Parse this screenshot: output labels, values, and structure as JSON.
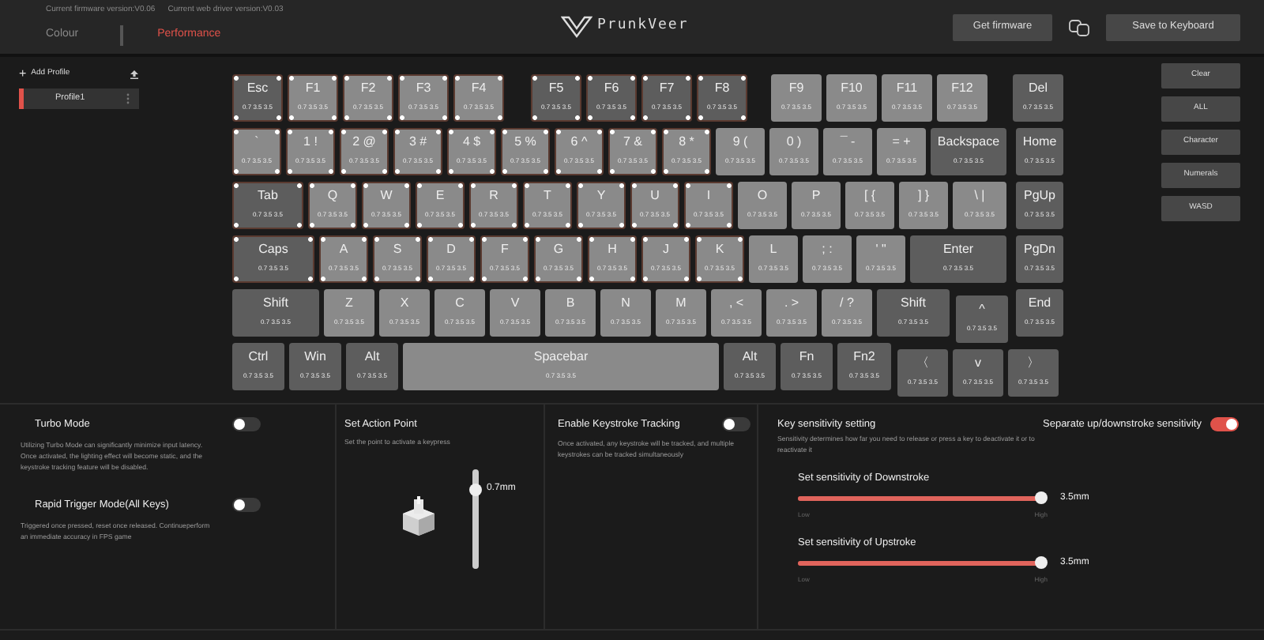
{
  "header": {
    "firmware_version": "Current firmware version:V0.06",
    "driver_version": "Current web driver version:V0.03",
    "tabs": [
      {
        "label": "Colour",
        "selected": false
      },
      {
        "label": "Performance",
        "selected": true
      }
    ],
    "logo": "PrunkVeer",
    "buttons": [
      "Get firmware",
      "Save to Keyboard"
    ]
  },
  "profiles": {
    "add_icon": "+",
    "add_label": "Add Profile",
    "items": [
      {
        "name": "Profile1",
        "selected": true
      }
    ]
  },
  "keyboard": {
    "rows": [
      {
        "keys": [
          {
            "label": "Esc",
            "values": "0.7 3.5 3.5",
            "kind": "dark",
            "selected": true
          },
          {
            "label": "F1",
            "values": "0.7 3.5 3.5",
            "kind": "light",
            "selected": true
          },
          {
            "label": "F2",
            "values": "0.7 3.5 3.5",
            "kind": "light",
            "selected": true
          },
          {
            "label": "F3",
            "values": "0.7 3.5 3.5",
            "kind": "light",
            "selected": true
          },
          {
            "label": "F4",
            "values": "0.7 3.5 3.5",
            "kind": "light",
            "selected": true
          },
          {
            "label": "F5",
            "values": "0.7 3.5 3.5",
            "kind": "dark",
            "selected": true
          },
          {
            "label": "F6",
            "values": "0.7 3.5 3.5",
            "kind": "dark",
            "selected": true
          },
          {
            "label": "F7",
            "values": "0.7 3.5 3.5",
            "kind": "dark",
            "selected": true
          },
          {
            "label": "F8",
            "values": "0.7 3.5 3.5",
            "kind": "dark",
            "selected": true
          },
          {
            "label": "F9",
            "values": "0.7 3.5 3.5",
            "kind": "light",
            "selected": false
          },
          {
            "label": "F10",
            "values": "0.7 3.5 3.5",
            "kind": "light",
            "selected": false
          },
          {
            "label": "F11",
            "values": "0.7 3.5 3.5",
            "kind": "light",
            "selected": false
          },
          {
            "label": "F12",
            "values": "0.7 3.5 3.5",
            "kind": "light",
            "selected": false
          },
          {
            "label": "Del",
            "values": "0.7 3.5 3.5",
            "kind": "dark",
            "selected": false
          }
        ]
      },
      {
        "keys": [
          {
            "label": "`",
            "values": "0.7 3.5 3.5",
            "kind": "light",
            "selected": true
          },
          {
            "label": "1 !",
            "values": "0.7 3.5 3.5",
            "kind": "light",
            "selected": true
          },
          {
            "label": "2 @",
            "values": "0.7 3.5 3.5",
            "kind": "light",
            "selected": true
          },
          {
            "label": "3 #",
            "values": "0.7 3.5 3.5",
            "kind": "light",
            "selected": true
          },
          {
            "label": "4 $",
            "values": "0.7 3.5 3.5",
            "kind": "light",
            "selected": true
          },
          {
            "label": "5 %",
            "values": "0.7 3.5 3.5",
            "kind": "light",
            "selected": true
          },
          {
            "label": "6 ^",
            "values": "0.7 3.5 3.5",
            "kind": "light",
            "selected": true
          },
          {
            "label": "7 &",
            "values": "0.7 3.5 3.5",
            "kind": "light",
            "selected": true
          },
          {
            "label": "8 *",
            "values": "0.7 3.5 3.5",
            "kind": "light",
            "selected": true
          },
          {
            "label": "9 (",
            "values": "0.7 3.5 3.5",
            "kind": "light",
            "selected": false
          },
          {
            "label": "0 )",
            "values": "0.7 3.5 3.5",
            "kind": "light",
            "selected": false
          },
          {
            "label": "¯ -",
            "values": "0.7 3.5 3.5",
            "kind": "light",
            "selected": false
          },
          {
            "label": "= +",
            "values": "0.7 3.5 3.5",
            "kind": "light",
            "selected": false
          },
          {
            "label": "Backspace",
            "values": "0.7 3.5 3.5",
            "kind": "dark",
            "selected": false
          },
          {
            "label": "Home",
            "values": "0.7 3.5 3.5",
            "kind": "dark",
            "selected": false
          }
        ]
      },
      {
        "keys": [
          {
            "label": "Tab",
            "values": "0.7 3.5 3.5",
            "kind": "dark",
            "selected": true
          },
          {
            "label": "Q",
            "values": "0.7 3.5 3.5",
            "kind": "light",
            "selected": true
          },
          {
            "label": "W",
            "values": "0.7 3.5 3.5",
            "kind": "light",
            "selected": true
          },
          {
            "label": "E",
            "values": "0.7 3.5 3.5",
            "kind": "light",
            "selected": true
          },
          {
            "label": "R",
            "values": "0.7 3.5 3.5",
            "kind": "light",
            "selected": true
          },
          {
            "label": "T",
            "values": "0.7 3.5 3.5",
            "kind": "light",
            "selected": true
          },
          {
            "label": "Y",
            "values": "0.7 3.5 3.5",
            "kind": "light",
            "selected": true
          },
          {
            "label": "U",
            "values": "0.7 3.5 3.5",
            "kind": "light",
            "selected": true
          },
          {
            "label": "I",
            "values": "0.7 3.5 3.5",
            "kind": "light",
            "selected": true
          },
          {
            "label": "O",
            "values": "0.7 3.5 3.5",
            "kind": "light",
            "selected": false
          },
          {
            "label": "P",
            "values": "0.7 3.5 3.5",
            "kind": "light",
            "selected": false
          },
          {
            "label": "[ {",
            "values": "0.7 3.5 3.5",
            "kind": "light",
            "selected": false
          },
          {
            "label": "] }",
            "values": "0.7 3.5 3.5",
            "kind": "light",
            "selected": false
          },
          {
            "label": "\\ |",
            "values": "0.7 3.5 3.5",
            "kind": "light",
            "selected": false
          },
          {
            "label": "PgUp",
            "values": "0.7 3.5 3.5",
            "kind": "dark",
            "selected": false
          }
        ]
      },
      {
        "keys": [
          {
            "label": "Caps",
            "values": "0.7 3.5 3.5",
            "kind": "dark",
            "selected": true
          },
          {
            "label": "A",
            "values": "0.7 3.5 3.5",
            "kind": "light",
            "selected": true
          },
          {
            "label": "S",
            "values": "0.7 3.5 3.5",
            "kind": "light",
            "selected": true
          },
          {
            "label": "D",
            "values": "0.7 3.5 3.5",
            "kind": "light",
            "selected": true
          },
          {
            "label": "F",
            "values": "0.7 3.5 3.5",
            "kind": "light",
            "selected": true
          },
          {
            "label": "G",
            "values": "0.7 3.5 3.5",
            "kind": "light",
            "selected": true
          },
          {
            "label": "H",
            "values": "0.7 3.5 3.5",
            "kind": "light",
            "selected": true
          },
          {
            "label": "J",
            "values": "0.7 3.5 3.5",
            "kind": "light",
            "selected": true
          },
          {
            "label": "K",
            "values": "0.7 3.5 3.5",
            "kind": "light",
            "selected": true
          },
          {
            "label": "L",
            "values": "0.7 3.5 3.5",
            "kind": "light",
            "selected": false
          },
          {
            "label": "; :",
            "values": "0.7 3.5 3.5",
            "kind": "light",
            "selected": false
          },
          {
            "label": "' \"",
            "values": "0.7 3.5 3.5",
            "kind": "light",
            "selected": false
          },
          {
            "label": "Enter",
            "values": "0.7 3.5 3.5",
            "kind": "dark",
            "selected": false
          },
          {
            "label": "PgDn",
            "values": "0.7 3.5 3.5",
            "kind": "dark",
            "selected": false
          }
        ]
      },
      {
        "keys": [
          {
            "label": "Shift",
            "values": "0.7 3.5 3.5",
            "kind": "dark",
            "selected": false
          },
          {
            "label": "Z",
            "values": "0.7 3.5 3.5",
            "kind": "light",
            "selected": false
          },
          {
            "label": "X",
            "values": "0.7 3.5 3.5",
            "kind": "light",
            "selected": false
          },
          {
            "label": "C",
            "values": "0.7 3.5 3.5",
            "kind": "light",
            "selected": false
          },
          {
            "label": "V",
            "values": "0.7 3.5 3.5",
            "kind": "light",
            "selected": false
          },
          {
            "label": "B",
            "values": "0.7 3.5 3.5",
            "kind": "light",
            "selected": false
          },
          {
            "label": "N",
            "values": "0.7 3.5 3.5",
            "kind": "light",
            "selected": false
          },
          {
            "label": "M",
            "values": "0.7 3.5 3.5",
            "kind": "light",
            "selected": false
          },
          {
            "label": ", <",
            "values": "0.7 3.5 3.5",
            "kind": "light",
            "selected": false
          },
          {
            "label": ". >",
            "values": "0.7 3.5 3.5",
            "kind": "light",
            "selected": false
          },
          {
            "label": "/ ?",
            "values": "0.7 3.5 3.5",
            "kind": "light",
            "selected": false
          },
          {
            "label": "Shift",
            "values": "0.7 3.5 3.5",
            "kind": "dark",
            "selected": false
          },
          {
            "label": "^",
            "values": "0.7 3.5 3.5",
            "kind": "dark",
            "selected": false
          },
          {
            "label": "End",
            "values": "0.7 3.5 3.5",
            "kind": "dark",
            "selected": false
          }
        ]
      },
      {
        "keys": [
          {
            "label": "Ctrl",
            "values": "0.7 3.5 3.5",
            "kind": "dark",
            "selected": false
          },
          {
            "label": "Win",
            "values": "0.7 3.5 3.5",
            "kind": "dark",
            "selected": false
          },
          {
            "label": "Alt",
            "values": "0.7 3.5 3.5",
            "kind": "dark",
            "selected": false
          },
          {
            "label": "Spacebar",
            "values": "0.7 3.5 3.5",
            "kind": "light",
            "selected": false
          },
          {
            "label": "Alt",
            "values": "0.7 3.5 3.5",
            "kind": "dark",
            "selected": false
          },
          {
            "label": "Fn",
            "values": "0.7 3.5 3.5",
            "kind": "dark",
            "selected": false
          },
          {
            "label": "Fn2",
            "values": "0.7 3.5 3.5",
            "kind": "dark",
            "selected": false
          },
          {
            "label": "〈",
            "values": "0.7 3.5 3.5",
            "kind": "dark",
            "selected": false
          },
          {
            "label": "v",
            "values": "0.7 3.5 3.5",
            "kind": "dark",
            "selected": false
          },
          {
            "label": "〉",
            "values": "0.7 3.5 3.5",
            "kind": "dark",
            "selected": false
          }
        ]
      }
    ]
  },
  "presets": [
    "Clear",
    "ALL",
    "Character",
    "Numerals",
    "WASD"
  ],
  "turbo": {
    "title": "Turbo Mode",
    "on": false,
    "description": "Utilizing Turbo Mode can significantly minimize input latency. Once activated, the lighting effect will become static, and the keystroke tracking feature will be disabled."
  },
  "rapid_trigger": {
    "title": "Rapid Trigger Mode(All Keys)",
    "on": false,
    "description": "Triggered once pressed, reset once released. Continueperform an immediate accuracy in FPS game"
  },
  "action_point": {
    "title": "Set Action Point",
    "description": "Set the point to activate a keypress",
    "reading": "0.7mm"
  },
  "keystroke_tracking": {
    "title": "Enable Keystroke Tracking",
    "on": false,
    "description": "Once activated, any keystroke will be tracked, and multiple keystrokes can be tracked simultaneously"
  },
  "sensitivity": {
    "title": "Key sensitivity setting",
    "description": "Sensitivity determines how far you need to release or press a key to deactivate it or to reactivate it",
    "separate": {
      "label": "Separate up/downstroke sensitivity",
      "on": true
    },
    "sliders": [
      {
        "label": "Set sensitivity of Downstroke",
        "level": 1,
        "reading": "3.5mm",
        "low": "Low",
        "high": "High"
      },
      {
        "label": "Set sensitivity of Upstroke",
        "level": 1,
        "reading": "3.5mm",
        "low": "Low",
        "high": "High"
      }
    ]
  }
}
